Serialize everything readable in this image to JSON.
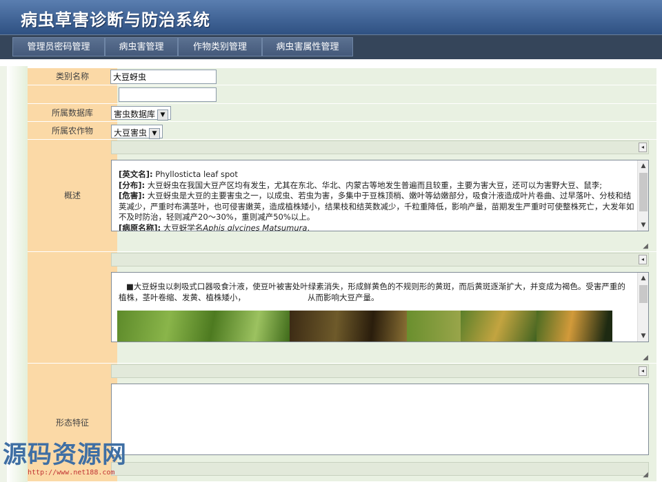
{
  "app": {
    "title": "病虫草害诊断与防治系统"
  },
  "nav": {
    "items": [
      {
        "label": "管理员密码管理"
      },
      {
        "label": "病虫害管理"
      },
      {
        "label": "作物类别管理"
      },
      {
        "label": "病虫害属性管理"
      }
    ]
  },
  "form": {
    "category_name": {
      "label": "类别名称",
      "value": "大豆蚜虫"
    },
    "second_field": {
      "label": "",
      "value": ""
    },
    "database": {
      "label": "所属数据库",
      "selected": "害虫数据库"
    },
    "crop": {
      "label": "所属农作物",
      "selected": "大豆害虫"
    },
    "summary": {
      "label": "概述",
      "lines": [
        {
          "key": "[英文名]:",
          "text": " Phyllosticta leaf spot"
        },
        {
          "key": "[分布]:",
          "text": " 大豆蚜虫在我国大豆产区均有发生，尤其在东北、华北、内蒙古等地发生普遍而且较重，主要为害大豆，还可以为害野大豆、鼠李;"
        },
        {
          "key": "[危害]:",
          "text": " 大豆蚜虫是大豆的主要害虫之一，以成虫、若虫为害，多集中于豆株顶梢、嫩叶等幼嫩部分，吸食汁液造成叶片卷曲、过早落叶、分枝和结荚减少，严重时布满茎叶，也可侵害嫩荚，造成植株矮小，结果枝和结荚数减少，千粒重降低，影响产量，苗期发生严重时可使整株死亡，大发年如不及时防治，轻则减产20～30%，重则减产50%以上。"
        },
        {
          "key": "[病原名称]:",
          "text": " 大豆蚜学名",
          "italic": "Aphis glycines Matsumura",
          "tail": "."
        }
      ]
    },
    "symptoms": {
      "label": "",
      "text1": "■大豆蚜虫以刺吸式口器吸食汁液，使豆叶被害处叶绿素消失，形成鲜黄色的不规则形的黄斑，而后黄斑逐渐扩大，并变成为褐色。受害严重的植株，茎叶卷缩、发黄、植株矮小，",
      "text2": "从而影响大豆产量。"
    },
    "morphology": {
      "label": "形态特征"
    }
  },
  "watermark": {
    "text": "源码资源网",
    "url": "http://www.net188.com"
  },
  "colors": {
    "header": "#3f6294",
    "nav": "#35455a",
    "label_bg": "#fbd9a6",
    "row_bg": "#e9f1e2"
  }
}
